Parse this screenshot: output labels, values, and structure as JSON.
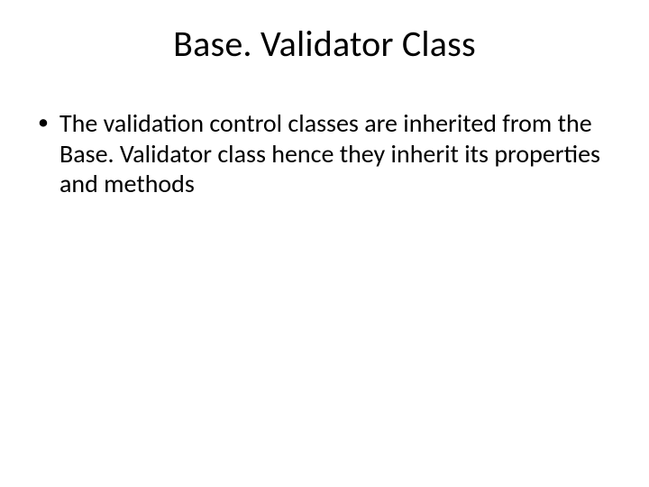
{
  "slide": {
    "title": "Base. Validator Class",
    "bullets": [
      "The validation control classes are inherited from the Base. Validator class hence they inherit its properties and methods"
    ]
  }
}
